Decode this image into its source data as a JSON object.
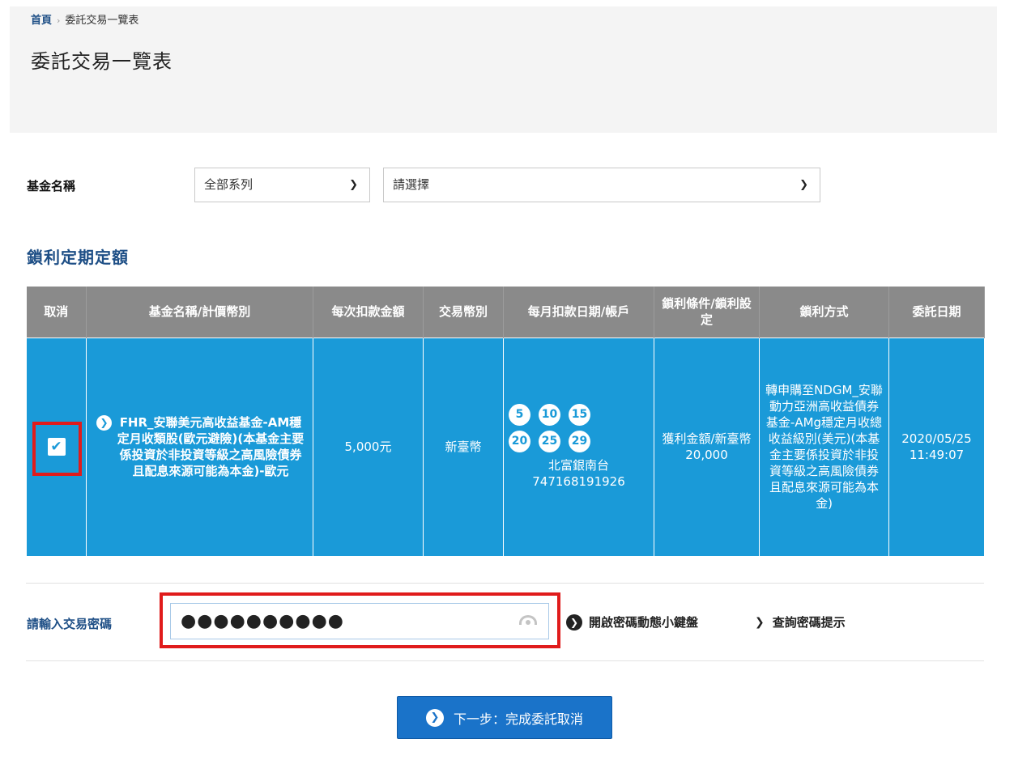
{
  "breadcrumb": {
    "home": "首頁",
    "separator": "›",
    "current": "委託交易一覽表"
  },
  "page": {
    "title": "委託交易一覽表"
  },
  "filter": {
    "label": "基金名稱",
    "series_select": {
      "value": "全部系列"
    },
    "fund_select": {
      "value": "請選擇"
    }
  },
  "section": {
    "title": "鎖利定期定額"
  },
  "table": {
    "headers": [
      "取消",
      "基金名稱/計價幣別",
      "每次扣款金額",
      "交易幣別",
      "每月扣款日期/帳戶",
      "鎖利條件/鎖利設定",
      "鎖利方式",
      "委託日期"
    ],
    "rows": [
      {
        "checked": true,
        "fund_name": "FHR_安聯美元高收益基金-AM穩定月收類股(歐元避險)(本基金主要係投資於非投資等級之高風險債券且配息來源可能為本金)-歐元",
        "amount": "5,000元",
        "currency": "新臺幣",
        "days": [
          "5",
          "10",
          "15",
          "20",
          "25",
          "29"
        ],
        "bank": "北富銀南台",
        "account": "747168191926",
        "lock_condition": "獲利金額/新臺幣 20,000",
        "lock_method": "轉申購至NDGM_安聯動力亞洲高收益債券基金-AMg穩定月收總收益級別(美元)(本基金主要係投資於非投資等級之高風險債券且配息來源可能為本金)",
        "order_date": "2020/05/25",
        "order_time": "11:49:07"
      }
    ]
  },
  "password": {
    "label": "請輸入交易密碼",
    "masked_value": "●●●●●●●●●●",
    "keyboard_link": "開啟密碼動態小鍵盤",
    "hint_link": "查詢密碼提示"
  },
  "actions": {
    "next_label": "下一步：完成委託取消"
  },
  "colors": {
    "accent": "#1a9ad8",
    "header_gray": "#8a8a8a",
    "brand_blue": "#1e4f86",
    "button_blue": "#1a73c9",
    "highlight_red": "#e01b1b"
  }
}
